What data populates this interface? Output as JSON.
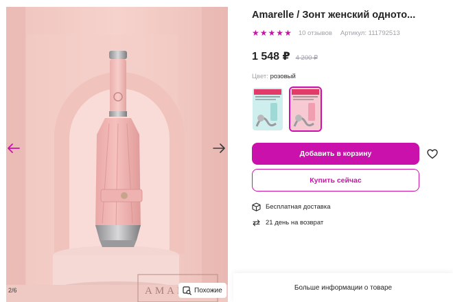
{
  "gallery": {
    "counter": "2/6",
    "similar_label": "Похожие",
    "brand_watermark": "AMAR",
    "icons": {
      "prev": "arrow-left-icon",
      "next": "arrow-right-icon",
      "similar": "image-search-icon"
    }
  },
  "product": {
    "title": "Amarelle / Зонт женский одното...",
    "rating": 5,
    "reviews": "10 отзывов",
    "article": "Артикул: 111792513",
    "price": "1 548 ₽",
    "old_price": "4 200 ₽",
    "color_label": "Цвет:",
    "color_value": "розовый",
    "variants": [
      {
        "color": "mint",
        "selected": false
      },
      {
        "color": "pink",
        "selected": true
      }
    ]
  },
  "actions": {
    "add_to_cart": "Добавить в корзину",
    "buy_now": "Купить сейчас",
    "favorite_icon": "heart-icon"
  },
  "features": [
    {
      "icon": "box-icon",
      "text": "Бесплатная доставка"
    },
    {
      "icon": "return-arrows-icon",
      "text": "21 день на возврат"
    }
  ],
  "more_info": "Больше информации о товаре",
  "colors": {
    "accent": "#cb11ab",
    "text": "#242424",
    "muted": "#a0a0a8"
  }
}
